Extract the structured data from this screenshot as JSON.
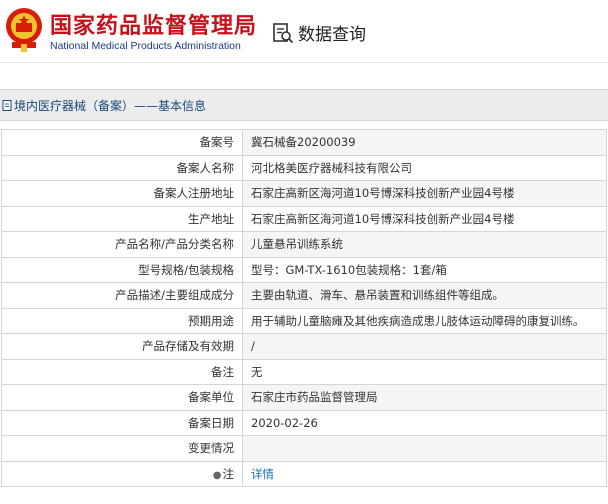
{
  "header": {
    "org_cn": "国家药品监督管理局",
    "org_en": "National Medical Products Administration",
    "query_label": "数据查询"
  },
  "breadcrumb": "境内医疗器械（备案）——基本信息",
  "rows": [
    {
      "key": "备案号",
      "value": "冀石械备20200039"
    },
    {
      "key": "备案人名称",
      "value": "河北格美医疗器械科技有限公司"
    },
    {
      "key": "备案人注册地址",
      "value": "石家庄高新区海河道10号博深科技创新产业园4号楼"
    },
    {
      "key": "生产地址",
      "value": "石家庄高新区海河道10号博深科技创新产业园4号楼"
    },
    {
      "key": "产品名称/产品分类名称",
      "value": "儿童悬吊训练系统"
    },
    {
      "key": "型号规格/包装规格",
      "value": "型号：GM-TX-1610包装规格：1套/箱"
    },
    {
      "key": "产品描述/主要组成成分",
      "value": "主要由轨道、滑车、悬吊装置和训练组件等组成。"
    },
    {
      "key": "预期用途",
      "value": "用于辅助儿童脑瘫及其他疾病造成患儿肢体运动障碍的康复训练。"
    },
    {
      "key": "产品存储及有效期",
      "value": "/"
    },
    {
      "key": "备注",
      "value": "无"
    },
    {
      "key": "备案单位",
      "value": "石家庄市药品监督管理局"
    },
    {
      "key": "备案日期",
      "value": "2020-02-26"
    },
    {
      "key": "变更情况",
      "value": ""
    }
  ],
  "note_row": {
    "key": "注",
    "link": "详情"
  },
  "colors": {
    "brand_red": "#c5121a",
    "link_blue": "#1a6fb7"
  }
}
